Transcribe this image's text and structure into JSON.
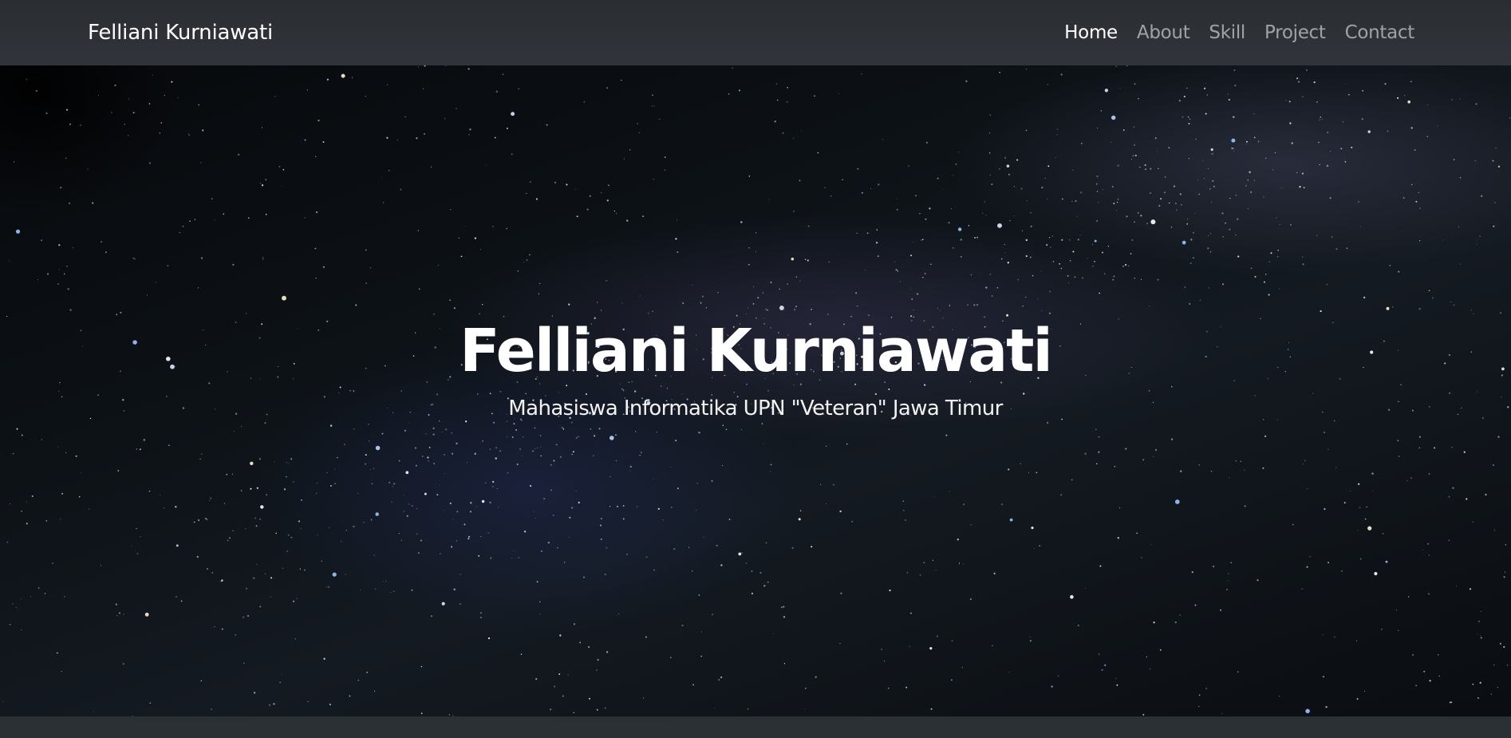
{
  "navbar": {
    "brand": "Felliani Kurniawati",
    "links": [
      {
        "label": "Home",
        "active": true
      },
      {
        "label": "About",
        "active": false
      },
      {
        "label": "Skill",
        "active": false
      },
      {
        "label": "Project",
        "active": false
      },
      {
        "label": "Contact",
        "active": false
      }
    ]
  },
  "hero": {
    "title": "Felliani Kurniawati",
    "subtitle": "Mahasiswa Informatika UPN \"Veteran\" Jawa Timur",
    "background": "starry-night-sky"
  },
  "colors": {
    "navbar_bg": "#2b3035",
    "nav_active": "#ffffff",
    "nav_inactive": "#8c8f93",
    "hero_text": "#ffffff"
  }
}
